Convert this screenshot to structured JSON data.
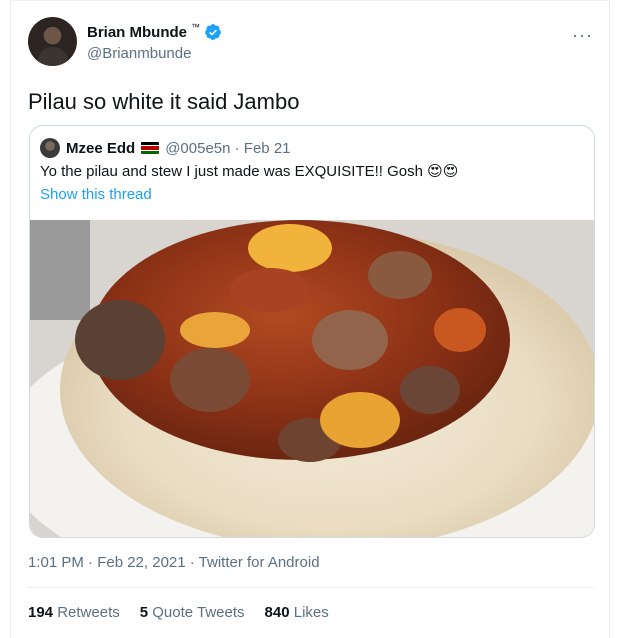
{
  "author": {
    "name": "Brian Mbunde",
    "trademark": "™",
    "handle": "@Brianmbunde"
  },
  "menu_icon": "more-horizontal-icon",
  "tweet_text": "Pilau so white it said Jambo",
  "quoted_tweet": {
    "name": "Mzee Edd",
    "flag": "kenya-flag-icon",
    "handle_date": "@005e5n · Feb 21",
    "text": "Yo the pilau and stew I just made was EXQUISITE!! Gosh 😍😍",
    "show_thread": "Show this thread",
    "photo": "plate of white rice with beef stew and potatoes"
  },
  "timestamp": "1:01 PM · Feb 22, 2021 · Twitter for Android",
  "stats": {
    "retweets_count": "194",
    "retweets_label": "Retweets",
    "quotes_count": "5",
    "quotes_label": "Quote Tweets",
    "likes_count": "840",
    "likes_label": "Likes"
  },
  "colors": {
    "link": "#1da1f2",
    "secondary_text": "#5b7083",
    "verified": "#1da1f2"
  }
}
